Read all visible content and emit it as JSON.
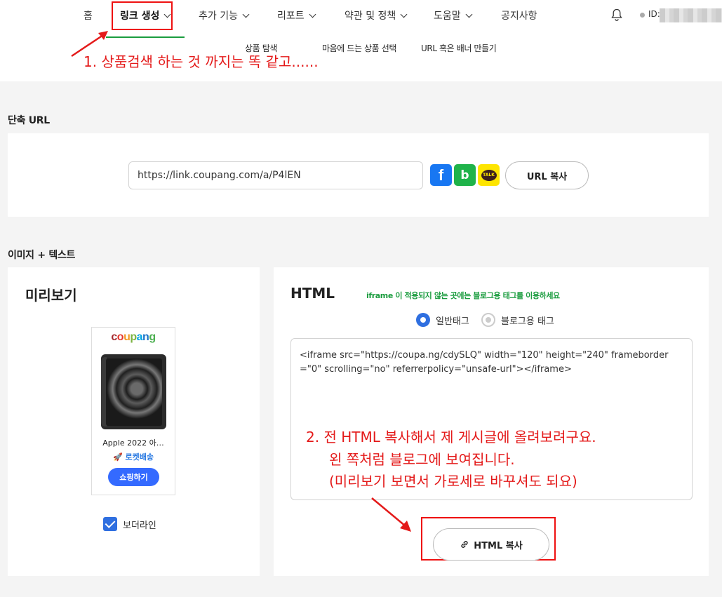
{
  "nav": {
    "home": "홈",
    "link_create": "링크 생성",
    "extra": "추가 기능",
    "report": "리포트",
    "terms": "약관 및 정책",
    "help": "도움말",
    "notice": "공지사항",
    "user_id": "ID:"
  },
  "subnav": {
    "search": "상품 탐색",
    "favorite": "마음에 드는 상품 선택",
    "url_banner": "URL 혹은 배너 만들기"
  },
  "annotations": {
    "a1": "1. 상품검색 하는 것 까지는 똑 같고......",
    "a2_line1": "2. 전 HTML 복사해서 제 게시글에 올려보려구요.",
    "a2_line2": "왼 쪽처럼 블로그에 보여집니다.",
    "a2_line3": "(미리보기 보면서 가로세로 바꾸셔도 되요)"
  },
  "short_url": {
    "section_title": "단축 URL",
    "value": "https://link.coupang.com/a/P4lEN",
    "copy_label": "URL 복사",
    "share_icons": [
      "facebook-icon",
      "band-icon",
      "kakaotalk-icon"
    ],
    "kakao_text": "TALK",
    "band_glyph": "b",
    "fb_glyph": "f"
  },
  "image_text": {
    "section_title": "이미지 + 텍스트",
    "preview": {
      "title": "미리보기",
      "logo": [
        "c",
        "o",
        "u",
        "p",
        "a",
        "n",
        "g"
      ],
      "logo_colors": [
        "#a4292e",
        "#e5362d",
        "#f29a27",
        "#7cb342",
        "#00a5e5",
        "#1a73c9",
        "#4caf50"
      ],
      "product_name": "Apple 2022 아…",
      "badge": "🚀 로켓배송",
      "shop_button": "쇼핑하기",
      "border_label": "보더라인"
    },
    "html": {
      "title": "HTML",
      "note": "iframe 이 적용되지 않는 곳에는 블로그용 태그를 이용하세요",
      "radio_general": "일반태그",
      "radio_blog": "블로그용 태그",
      "code": "<iframe src=\"https://coupa.ng/cdySLQ\" width=\"120\" height=\"240\" frameborder=\"0\" scrolling=\"no\" referrerpolicy=\"unsafe-url\"></iframe>",
      "copy_label": "HTML 복사"
    }
  },
  "colors": {
    "accent_green": "#1a9c3e",
    "annotation_red": "#e41a1a",
    "primary_blue": "#2f6fe0"
  }
}
